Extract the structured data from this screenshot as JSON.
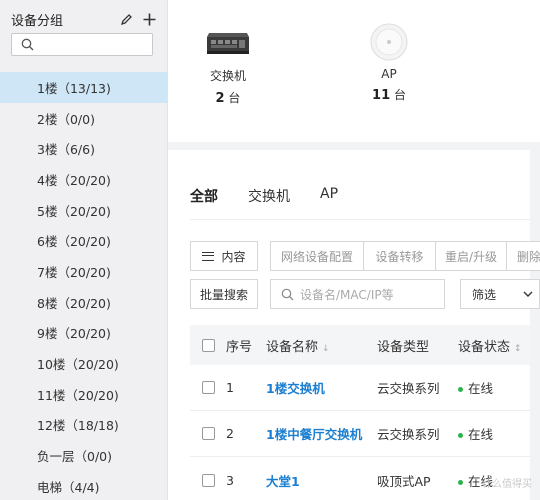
{
  "sidebar": {
    "title": "设备分组",
    "items": [
      {
        "label": "1楼（13/13)"
      },
      {
        "label": "2楼（0/0)"
      },
      {
        "label": "3楼（6/6)"
      },
      {
        "label": "4楼（20/20)"
      },
      {
        "label": "5楼（20/20)"
      },
      {
        "label": "6楼（20/20)"
      },
      {
        "label": "7楼（20/20)"
      },
      {
        "label": "8楼（20/20)"
      },
      {
        "label": "9楼（20/20)"
      },
      {
        "label": "10楼（20/20)"
      },
      {
        "label": "11楼（20/20)"
      },
      {
        "label": "12楼（18/18)"
      },
      {
        "label": "负一层（0/0)"
      },
      {
        "label": "电梯（4/4)"
      }
    ],
    "active_index": 0
  },
  "stats": {
    "switch": {
      "name": "交换机",
      "count": "2",
      "unit": "台"
    },
    "ap": {
      "name": "AP",
      "count": "11",
      "unit": "台"
    }
  },
  "tabs": [
    "全部",
    "交换机",
    "AP"
  ],
  "toolbar": {
    "menu_label": "内容",
    "actions": [
      "网络设备配置",
      "设备转移",
      "重启/升级",
      "删除"
    ],
    "bulk_search": "批量搜索",
    "search_placeholder": "设备名/MAC/IP等",
    "filter_label": "筛选"
  },
  "table": {
    "headers": {
      "no": "序号",
      "name": "设备名称",
      "type": "设备类型",
      "status": "设备状态"
    },
    "rows": [
      {
        "no": "1",
        "name": "1楼交换机",
        "type": "云交换系列",
        "status": "在线"
      },
      {
        "no": "2",
        "name": "1楼中餐厅交换机",
        "type": "云交换系列",
        "status": "在线"
      },
      {
        "no": "3",
        "name": "大堂1",
        "type": "吸顶式AP",
        "status": "在线"
      }
    ]
  },
  "colors": {
    "accent": "#1b7fd1",
    "active_bg": "#cfe6f7",
    "online": "#2db34a"
  },
  "watermark": "什么值得买"
}
